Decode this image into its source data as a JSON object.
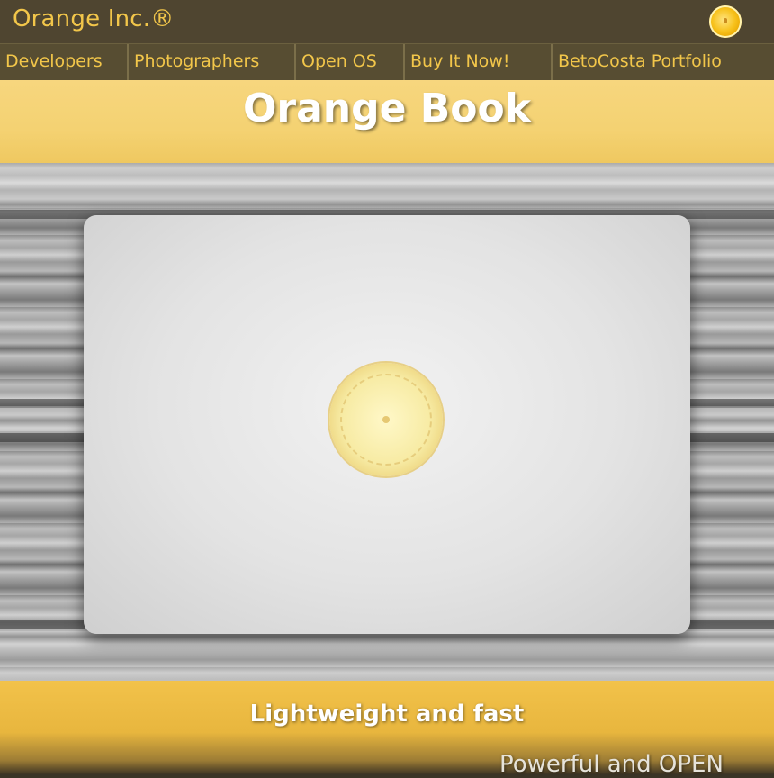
{
  "header": {
    "brand": "Orange Inc.®",
    "logo_icon": "orange-slice-icon"
  },
  "nav": {
    "items": [
      {
        "label": "Developers"
      },
      {
        "label": "Photographers"
      },
      {
        "label": "Open OS"
      },
      {
        "label": "Buy It Now!"
      },
      {
        "label": "BetoCosta Portfolio"
      }
    ]
  },
  "hero": {
    "title": "Orange Book",
    "image_icon": "laptop-with-orange-logo"
  },
  "sections": {
    "tagline_1": "Lightweight and fast",
    "tagline_2": "Powerful and OPEN"
  },
  "colors": {
    "accent": "#f2c64a",
    "header_bg": "#4f4530",
    "band": "#f4d272"
  }
}
